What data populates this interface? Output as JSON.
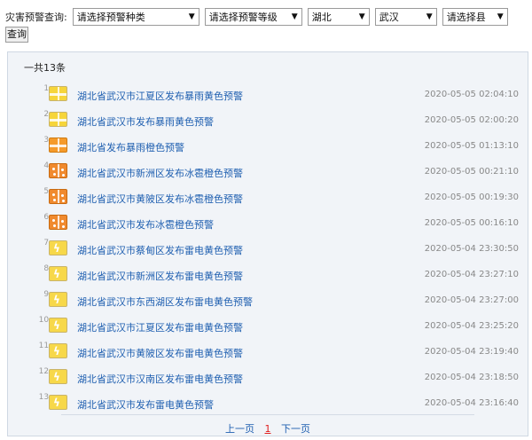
{
  "filters": {
    "label": "灾害预警查询:",
    "warning_type": "请选择预警种类",
    "warning_level": "请选择预警等级",
    "province": "湖北",
    "city": "武汉",
    "county": "请选择县",
    "query_button": "查询"
  },
  "total_text": "一共13条",
  "alerts": [
    {
      "index": "1.",
      "title": "湖北省武汉市江夏区发布暴雨黄色预警",
      "time": "2020-05-05 02:04:10",
      "icon": "rainstorm-yellow-icon",
      "icon_color": "#f6d53a"
    },
    {
      "index": "2.",
      "title": "湖北省武汉市发布暴雨黄色预警",
      "time": "2020-05-05 02:00:20",
      "icon": "rainstorm-yellow-icon",
      "icon_color": "#f6d53a"
    },
    {
      "index": "3.",
      "title": "湖北省发布暴雨橙色预警",
      "time": "2020-05-05 01:13:10",
      "icon": "rainstorm-orange-icon",
      "icon_color": "#f59a2a"
    },
    {
      "index": "4.",
      "title": "湖北省武汉市新洲区发布冰雹橙色预警",
      "time": "2020-05-05 00:21:10",
      "icon": "hail-orange-icon",
      "icon_color": "#f08a2e"
    },
    {
      "index": "5.",
      "title": "湖北省武汉市黄陂区发布冰雹橙色预警",
      "time": "2020-05-05 00:19:30",
      "icon": "hail-orange-icon",
      "icon_color": "#f08a2e"
    },
    {
      "index": "6.",
      "title": "湖北省武汉市发布冰雹橙色预警",
      "time": "2020-05-05 00:16:10",
      "icon": "hail-orange-icon",
      "icon_color": "#f08a2e"
    },
    {
      "index": "7.",
      "title": "湖北省武汉市蔡甸区发布雷电黄色预警",
      "time": "2020-05-04 23:30:50",
      "icon": "thunder-yellow-icon",
      "icon_color": "#f7d84a"
    },
    {
      "index": "8.",
      "title": "湖北省武汉市新洲区发布雷电黄色预警",
      "time": "2020-05-04 23:27:10",
      "icon": "thunder-yellow-icon",
      "icon_color": "#f7d84a"
    },
    {
      "index": "9.",
      "title": "湖北省武汉市东西湖区发布雷电黄色预警",
      "time": "2020-05-04 23:27:00",
      "icon": "thunder-yellow-icon",
      "icon_color": "#f7d84a"
    },
    {
      "index": "10.",
      "title": "湖北省武汉市江夏区发布雷电黄色预警",
      "time": "2020-05-04 23:25:20",
      "icon": "thunder-yellow-icon",
      "icon_color": "#f7d84a"
    },
    {
      "index": "11.",
      "title": "湖北省武汉市黄陂区发布雷电黄色预警",
      "time": "2020-05-04 23:19:40",
      "icon": "thunder-yellow-icon",
      "icon_color": "#f7d84a"
    },
    {
      "index": "12.",
      "title": "湖北省武汉市汉南区发布雷电黄色预警",
      "time": "2020-05-04 23:18:50",
      "icon": "thunder-yellow-icon",
      "icon_color": "#f7d84a"
    },
    {
      "index": "13.",
      "title": "湖北省武汉市发布雷电黄色预警",
      "time": "2020-05-04 23:16:40",
      "icon": "thunder-yellow-icon",
      "icon_color": "#f7d84a"
    }
  ],
  "pager": {
    "prev": "上一页",
    "current": "1",
    "next": "下一页"
  },
  "colors": {
    "link": "#1f5fb0",
    "panel_bg": "#f1f4f8",
    "current_page": "#e02020"
  }
}
